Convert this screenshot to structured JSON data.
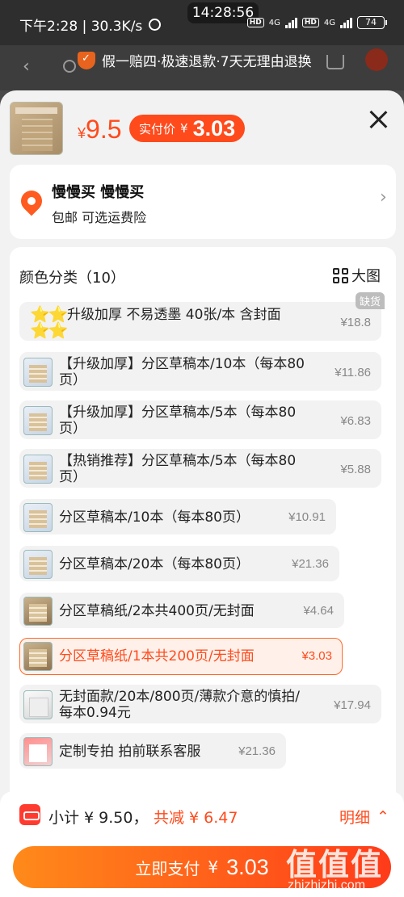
{
  "status_bar": {
    "left": "下午2:28 | 30.3K/s",
    "time": "14:28:56",
    "net1": "4G",
    "net2": "4G",
    "hd": "HD",
    "battery": "74"
  },
  "dim_header": {
    "guarantee": "假一赔四·极速退款·7天无理由退换"
  },
  "product": {
    "price_symbol": "¥",
    "price": "9.5",
    "real_price_label": "实付价",
    "real_price_symbol": "¥",
    "real_price": "3.03"
  },
  "address": {
    "name": "慢慢买 慢慢买",
    "sub": "包邮  可选运费险"
  },
  "sku": {
    "title": "颜色分类（10）",
    "big_image_label": "大图",
    "out_of_stock": "缺货",
    "options": [
      {
        "label": "升级加厚 不易透墨 40张/本 含封面",
        "price": "¥18.8",
        "thumb": "stars"
      },
      {
        "label": "【升级加厚】分区草稿本/10本（每本80页）",
        "price": "¥11.86",
        "thumb": "blue"
      },
      {
        "label": "【升级加厚】分区草稿本/5本（每本80页）",
        "price": "¥6.83",
        "thumb": "blue"
      },
      {
        "label": "【热销推荐】分区草稿本/5本（每本80页）",
        "price": "¥5.88",
        "thumb": "blue"
      },
      {
        "label": "分区草稿本/10本（每本80页）",
        "price": "¥10.91",
        "thumb": "blue"
      },
      {
        "label": "分区草稿本/20本（每本80页）",
        "price": "¥21.36",
        "thumb": "blue"
      },
      {
        "label": "分区草稿纸/2本共400页/无封面",
        "price": "¥4.64",
        "thumb": "beige"
      },
      {
        "label": "分区草稿纸/1本共200页/无封面",
        "price": "¥3.03",
        "thumb": "beige",
        "selected": true
      },
      {
        "label": "无封面款/20本/800页/薄款介意的慎拍/每本0.94元",
        "price": "¥17.94",
        "thumb": "white"
      },
      {
        "label": "定制专拍 拍前联系客服",
        "price": "¥21.36",
        "thumb": "pink"
      }
    ]
  },
  "bottom": {
    "subtotal": "小计 ¥ 9.50，",
    "discount": "共减 ¥ 6.47",
    "detail": "明细",
    "pay_label": "立即支付",
    "pay_symbol": "¥",
    "pay_amount": "3.03"
  },
  "watermark": {
    "glyphs": "值值值",
    "url": "zhizhizhi.com"
  },
  "colors": {
    "accent": "#ff4a1c",
    "selected_bg": "#fff1ea",
    "star": "#f3c21b"
  }
}
